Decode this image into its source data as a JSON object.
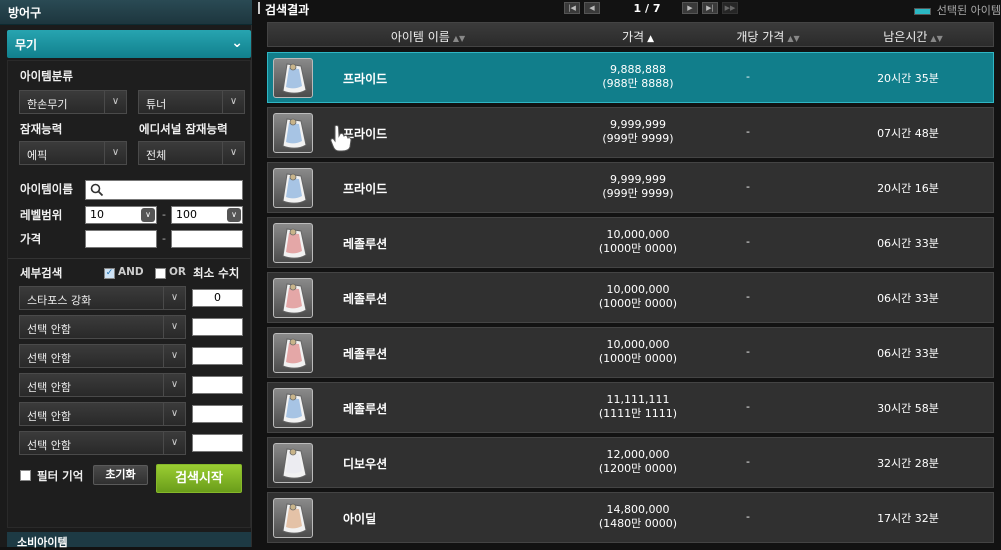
{
  "sidebar": {
    "category_top": "방어구",
    "category_selected": "무기",
    "category_bottom": "소비아이템",
    "labels": {
      "item_class": "아이템분류",
      "potential": "잠재능력",
      "additional_potential": "에디셔널 잠재능력",
      "item_name": "아이템이름",
      "level_range": "레벨범위",
      "price": "가격",
      "detail_search": "세부검색",
      "and": "AND",
      "or": "OR",
      "min_value": "최소 수치",
      "filter_memory": "필터 기억"
    },
    "item_class_value": "한손무기",
    "item_sub_value": "튜너",
    "potential_value": "에픽",
    "additional_potential_value": "전체",
    "item_name_value": "",
    "level_min": "10",
    "level_max": "100",
    "price_min": "",
    "price_max": "",
    "detail_options": [
      {
        "label": "스타포스 강화",
        "min": "0"
      },
      {
        "label": "선택 안함",
        "min": ""
      },
      {
        "label": "선택 안함",
        "min": ""
      },
      {
        "label": "선택 안함",
        "min": ""
      },
      {
        "label": "선택 안함",
        "min": ""
      },
      {
        "label": "선택 안함",
        "min": ""
      }
    ],
    "reset_button": "초기화",
    "search_button": "검색시작"
  },
  "results": {
    "title": "검색결과",
    "page": "1 / 7",
    "legend": "선택된 아이템",
    "columns": {
      "name": "아이템 이름",
      "price": "가격",
      "unit_price": "개당 가격",
      "remaining": "남은시간"
    },
    "rows": [
      {
        "name": "프라이드",
        "price": "9,888,888",
        "price_kr": "(988만 8888)",
        "unit": "-",
        "time": "20시간 35분",
        "selected": true
      },
      {
        "name": "프라이드",
        "price": "9,999,999",
        "price_kr": "(999만 9999)",
        "unit": "-",
        "time": "07시간 48분",
        "selected": false
      },
      {
        "name": "프라이드",
        "price": "9,999,999",
        "price_kr": "(999만 9999)",
        "unit": "-",
        "time": "20시간 16분",
        "selected": false
      },
      {
        "name": "레졸루션",
        "price": "10,000,000",
        "price_kr": "(1000만 0000)",
        "unit": "-",
        "time": "06시간 33분",
        "selected": false
      },
      {
        "name": "레졸루션",
        "price": "10,000,000",
        "price_kr": "(1000만 0000)",
        "unit": "-",
        "time": "06시간 33분",
        "selected": false
      },
      {
        "name": "레졸루션",
        "price": "10,000,000",
        "price_kr": "(1000만 0000)",
        "unit": "-",
        "time": "06시간 33분",
        "selected": false
      },
      {
        "name": "레졸루션",
        "price": "11,111,111",
        "price_kr": "(1111만 1111)",
        "unit": "-",
        "time": "30시간 58분",
        "selected": false
      },
      {
        "name": "디보우션",
        "price": "12,000,000",
        "price_kr": "(1200만 0000)",
        "unit": "-",
        "time": "32시간 28분",
        "selected": false
      },
      {
        "name": "아이딜",
        "price": "14,800,000",
        "price_kr": "(1480만 0000)",
        "unit": "-",
        "time": "17시간 32분",
        "selected": false
      }
    ]
  },
  "colors": {
    "accent": "#1a8f9c",
    "search_button": "#8cc63f",
    "selected_row": "#117e8b"
  }
}
